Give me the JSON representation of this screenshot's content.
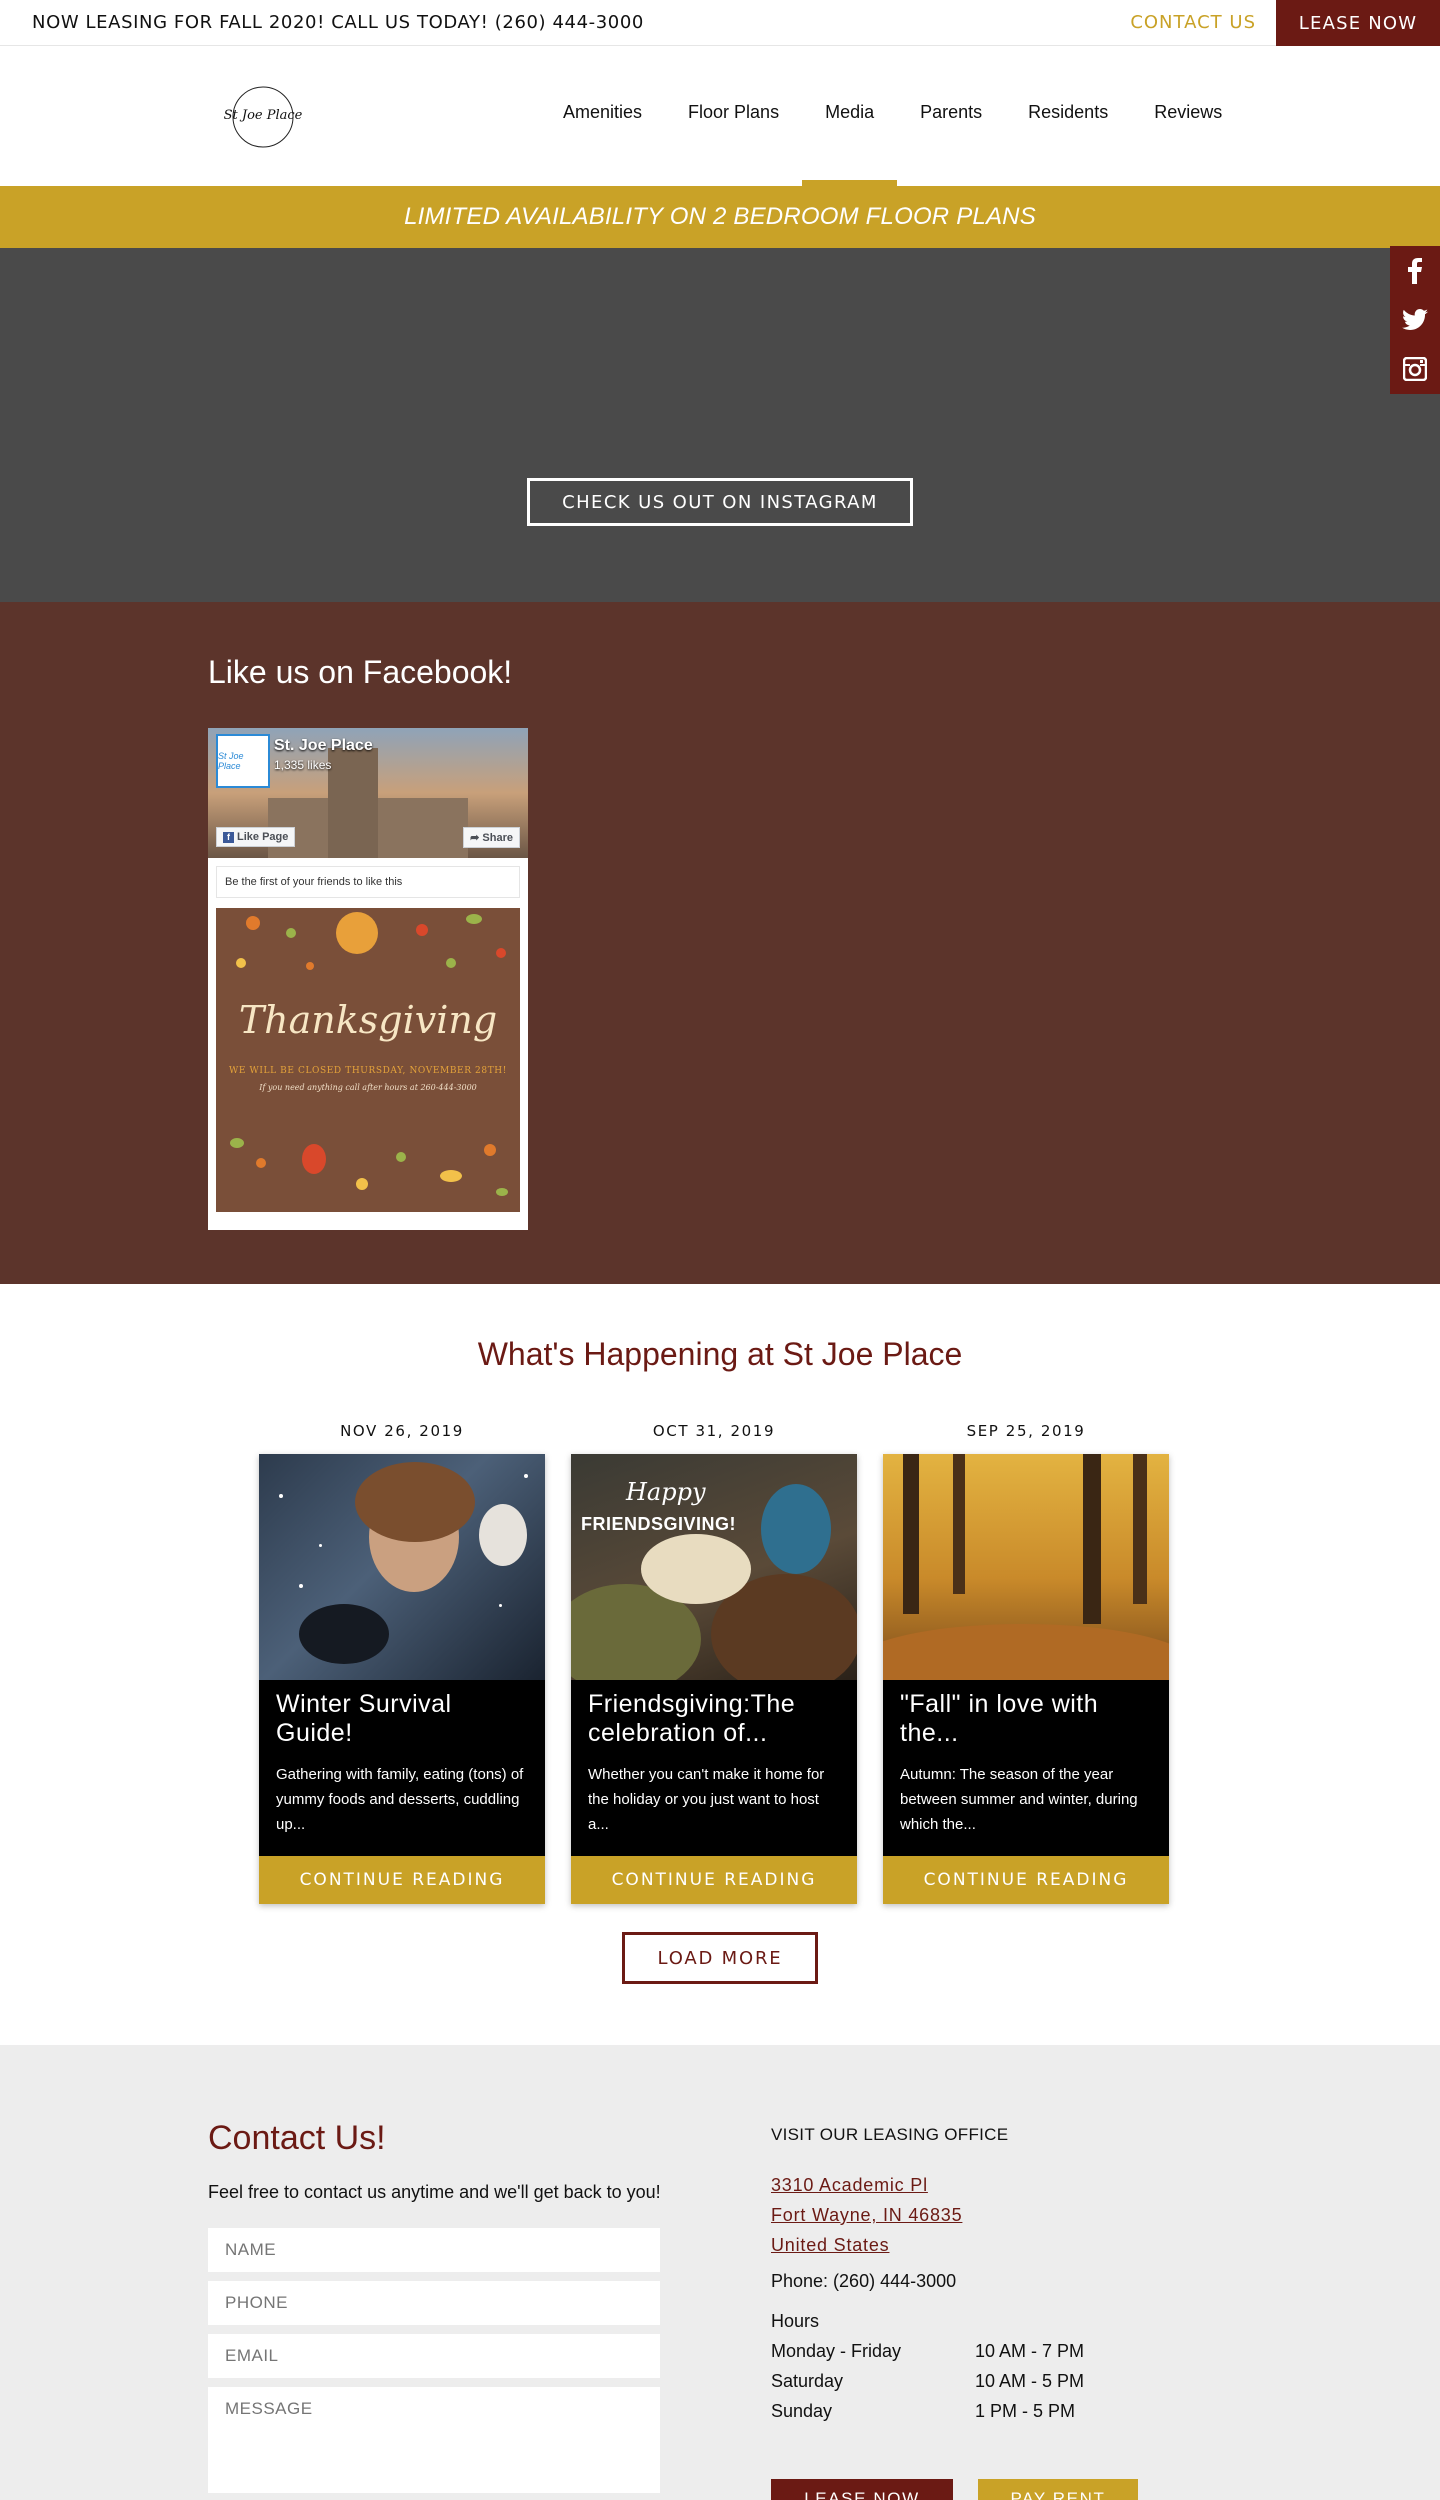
{
  "topbar": {
    "announcement": "NOW LEASING FOR FALL 2020! CALL US TODAY! (260) 444-3000",
    "contact_label": "CONTACT US",
    "lease_label": "LEASE NOW"
  },
  "header": {
    "logo_text": "St Joe Place",
    "nav": [
      {
        "label": "Amenities"
      },
      {
        "label": "Floor Plans"
      },
      {
        "label": "Media",
        "active": true
      },
      {
        "label": "Parents"
      },
      {
        "label": "Residents"
      },
      {
        "label": "Reviews"
      }
    ]
  },
  "banner": {
    "text": "LIMITED AVAILABILITY ON 2 BEDROOM FLOOR PLANS"
  },
  "hero": {
    "button_label": "CHECK US OUT ON INSTAGRAM"
  },
  "social": {
    "icons": [
      "facebook-icon",
      "twitter-icon",
      "instagram-icon"
    ]
  },
  "facebook": {
    "heading": "Like us on Facebook!",
    "page_name": "St. Joe Place",
    "likes": "1,335 likes",
    "like_button": "Like Page",
    "share_button": "Share",
    "friends_text": "Be the first of your friends to like this",
    "post": {
      "title": "Thanksgiving",
      "line1": "WE WILL BE CLOSED THURSDAY, NOVEMBER 28TH!",
      "line2": "If you need anything call after hours at 260-444-3000"
    }
  },
  "happening": {
    "title": "What's Happening at St Joe Place",
    "cards": [
      {
        "date": "NOV 26, 2019",
        "title": "Winter Survival Guide!",
        "excerpt": "Gathering with family, eating (tons) of yummy foods and desserts, cuddling up...",
        "cta": "CONTINUE READING"
      },
      {
        "date": "OCT 31, 2019",
        "title": "Friendsgiving:The celebration of...",
        "excerpt": "Whether you can't make it home for the holiday or you just want to host a...",
        "cta": "CONTINUE READING",
        "image_text_1": "Happy",
        "image_text_2": "FRIENDSGIVING!"
      },
      {
        "date": "SEP 25, 2019",
        "title": "\"Fall\" in love with the...",
        "excerpt": "Autumn: The season of the year between summer and winter, during which the...",
        "cta": "CONTINUE READING"
      }
    ],
    "load_more": "LOAD MORE"
  },
  "contact": {
    "heading": "Contact Us!",
    "intro": "Feel free to contact us anytime and we'll get back to you!",
    "placeholders": {
      "name": "NAME",
      "phone": "PHONE",
      "email": "EMAIL",
      "message": "MESSAGE"
    },
    "visit_label": "VISIT OUR LEASING OFFICE",
    "address": [
      "3310 Academic Pl",
      "Fort Wayne, IN 46835",
      "United States"
    ],
    "phone": "Phone: (260) 444-3000",
    "hours_label": "Hours",
    "hours": [
      {
        "day": "Monday - Friday",
        "time": "10 AM - 7 PM"
      },
      {
        "day": "Saturday",
        "time": "10 AM - 5 PM"
      },
      {
        "day": "Sunday",
        "time": "1 PM - 5 PM"
      }
    ],
    "lease_button": "LEASE NOW",
    "pay_button": "PAY RENT"
  },
  "colors": {
    "maroon": "#6b1a14",
    "gold": "#c9a227",
    "brown": "#5c342b",
    "hero_gray": "#4a4a4a",
    "footer_gray": "#ededed"
  }
}
